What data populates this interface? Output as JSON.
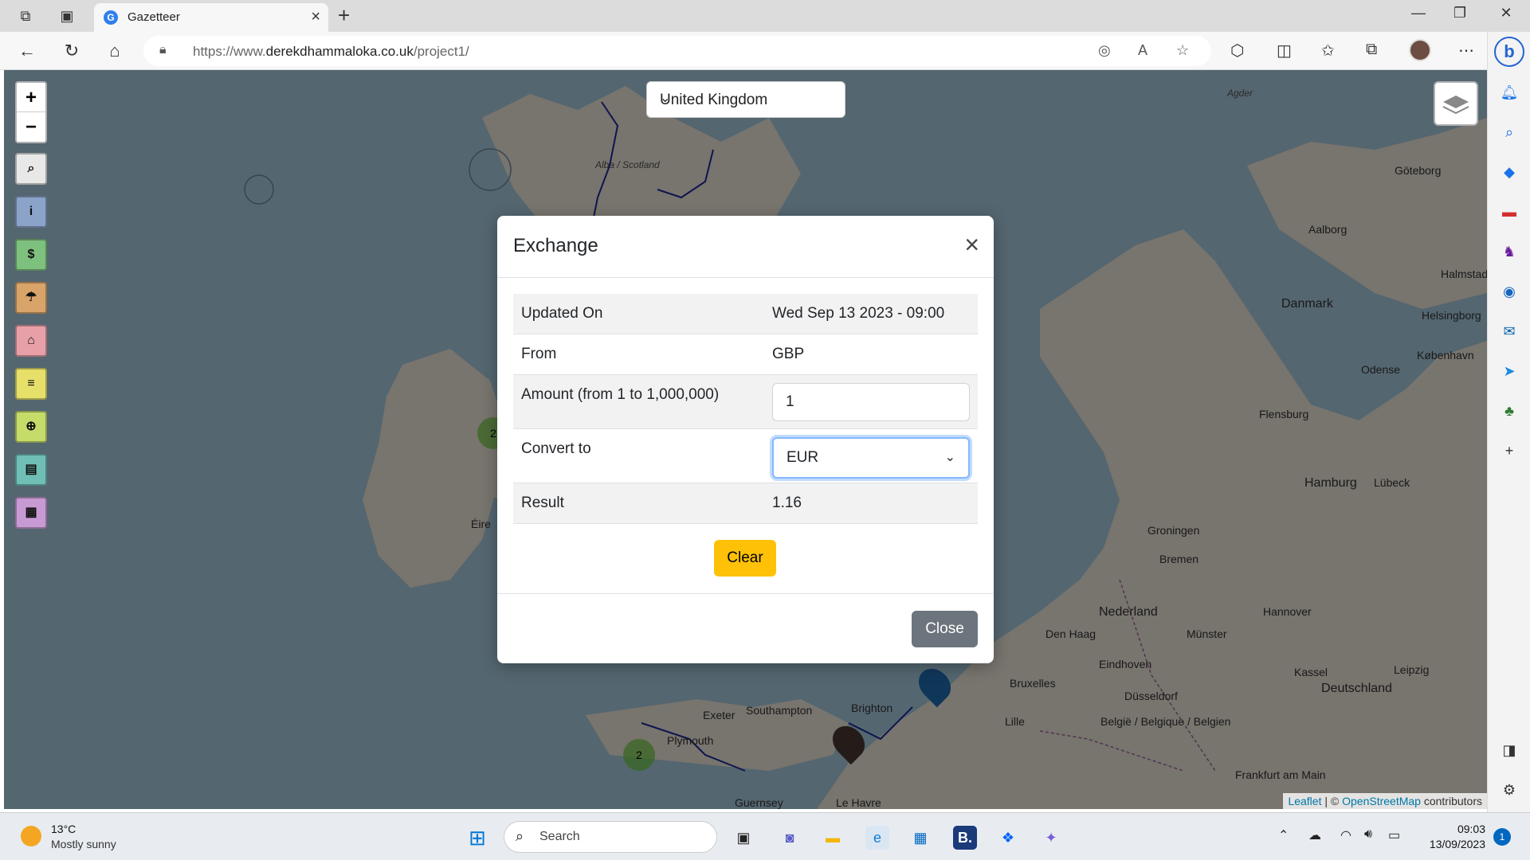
{
  "browser": {
    "tab_title": "Gazetteer",
    "tab_favicon": "G",
    "url_prefix": "https://www.",
    "url_domain": "derekdhammaloka.co.uk",
    "url_path": "/project1/"
  },
  "map": {
    "country_selected": "United Kingdom",
    "zoom_in": "+",
    "zoom_out": "−",
    "buttons": [
      {
        "icon": "search-icon",
        "color": "#e8e8e8"
      },
      {
        "icon": "info-icon",
        "color": "#8ba3c9"
      },
      {
        "icon": "dollar-icon",
        "color": "#7ec07e"
      },
      {
        "icon": "umbrella-icon",
        "color": "#d9a46a"
      },
      {
        "icon": "bank-icon",
        "color": "#e8a0a8"
      },
      {
        "icon": "database-icon",
        "color": "#e6e06b"
      },
      {
        "icon": "crosshair-icon",
        "color": "#c5db6a"
      },
      {
        "icon": "id-card-icon",
        "color": "#6fbfb7"
      },
      {
        "icon": "newspaper-icon",
        "color": "#c89ad4"
      }
    ],
    "labels": {
      "scotland": "Alba / Scotland",
      "eire": "Éire",
      "danmark": "Danmark",
      "kobenhavn": "København",
      "goteborg": "Göteborg",
      "aalborg": "Aalborg",
      "odense": "Odense",
      "hamburg": "Hamburg",
      "bremen": "Bremen",
      "hannover": "Hannover",
      "nederland": "Nederland",
      "den_haag": "Den Haag",
      "dusseldorf": "Düsseldorf",
      "deutschland": "Deutschland",
      "belgie": "België / Belgique / Belgien",
      "brighton": "Brighton",
      "plymouth": "Plymouth",
      "southampton": "Southampton",
      "exeter": "Exeter",
      "frankfurt": "Frankfurt am Main",
      "leipzig": "Leipzig",
      "groningen": "Groningen",
      "bruxelles": "Bruxelles",
      "lille": "Lille",
      "guernsey": "Guernsey",
      "le_havre": "Le Havre",
      "kassel": "Kassel",
      "flensburg": "Flensburg",
      "lubeck": "Lübeck",
      "eindhoven": "Eindhoven",
      "munster": "Münster",
      "helsingborg": "Helsingborg",
      "halmstad": "Halmstad",
      "agder": "Agder"
    },
    "clusters": [
      "2",
      "2"
    ],
    "attribution_leaflet": "Leaflet",
    "attribution_sep": " | © ",
    "attribution_osm": "OpenStreetMap",
    "attribution_tail": " contributors"
  },
  "modal": {
    "title": "Exchange",
    "close_x": "×",
    "rows": {
      "updated_label": "Updated On",
      "updated_value": "Wed Sep 13 2023 - 09:00",
      "from_label": "From",
      "from_value": "GBP",
      "amount_label": "Amount (from 1 to 1,000,000)",
      "amount_value": "1",
      "convert_label": "Convert to",
      "convert_value": "EUR",
      "result_label": "Result",
      "result_value": "1.16"
    },
    "clear_button": "Clear",
    "close_button": "Close"
  },
  "taskbar": {
    "weather_temp": "13°C",
    "weather_desc": "Mostly sunny",
    "search_placeholder": "Search",
    "time": "09:03",
    "date": "13/09/2023",
    "notifications": "1"
  }
}
